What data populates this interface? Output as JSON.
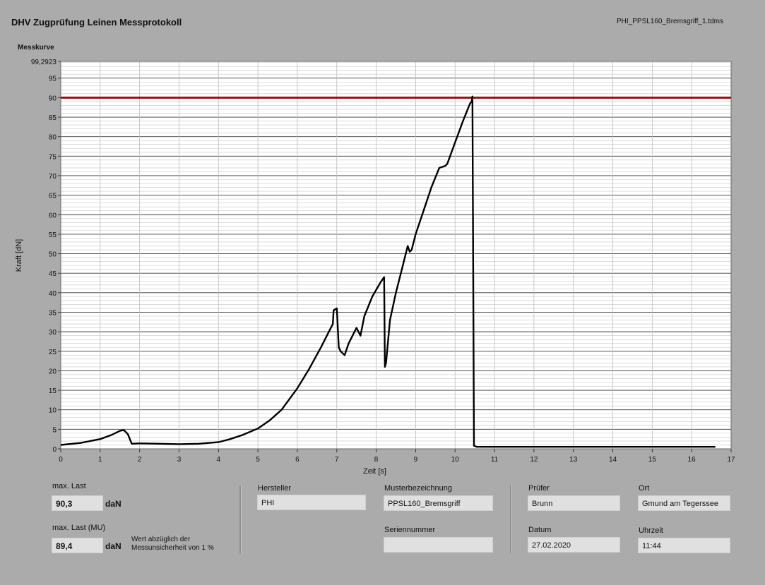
{
  "header": {
    "title": "DHV Zugprüfung Leinen Messprotokoll",
    "filename": "PHI_PPSL160_Bremsgriff_1.tdms",
    "chart_label": "Messkurve"
  },
  "colors": {
    "background": "#ababab",
    "plot_bg": "#ffffff",
    "limit_line": "#9b1010",
    "curve": "#000000"
  },
  "chart_data": {
    "type": "line",
    "xlabel": "Zeit [s]",
    "ylabel": "Kraft [dN]",
    "xlim": [
      0,
      17
    ],
    "ylim": [
      0,
      99.2923
    ],
    "ymax_label": "99,2923",
    "xticks": [
      "0",
      "1",
      "2",
      "3",
      "4",
      "5",
      "6",
      "7",
      "8",
      "9",
      "10",
      "11",
      "12",
      "13",
      "14",
      "15",
      "16",
      "17"
    ],
    "yticks": [
      "0",
      "5",
      "10",
      "15",
      "20",
      "25",
      "30",
      "35",
      "40",
      "45",
      "50",
      "55",
      "60",
      "65",
      "70",
      "75",
      "80",
      "85",
      "90",
      "95"
    ],
    "grid": true,
    "series": [
      {
        "role": "limit",
        "x": [
          0,
          17
        ],
        "y": [
          90,
          90
        ]
      },
      {
        "role": "measurement",
        "x": [
          0,
          0.5,
          1.0,
          1.3,
          1.5,
          1.6,
          1.7,
          1.8,
          2.0,
          2.5,
          3.0,
          3.5,
          4.0,
          4.3,
          4.6,
          5.0,
          5.3,
          5.6,
          6.0,
          6.3,
          6.6,
          6.9,
          6.92,
          7.0,
          7.05,
          7.1,
          7.2,
          7.3,
          7.4,
          7.5,
          7.6,
          7.7,
          7.9,
          8.1,
          8.2,
          8.22,
          8.25,
          8.35,
          8.5,
          8.7,
          8.8,
          8.85,
          8.9,
          9.0,
          9.2,
          9.4,
          9.6,
          9.75,
          9.8,
          10.0,
          10.2,
          10.3,
          10.38,
          10.42,
          10.44,
          10.48,
          10.55,
          11,
          12,
          13,
          14,
          15,
          16,
          16.6
        ],
        "y": [
          1.0,
          1.5,
          2.5,
          3.6,
          4.6,
          4.8,
          3.8,
          1.3,
          1.4,
          1.3,
          1.2,
          1.3,
          1.7,
          2.5,
          3.5,
          5.2,
          7.3,
          10.0,
          15.5,
          20.5,
          26.0,
          32.0,
          35.5,
          36.0,
          26.0,
          25.0,
          24.0,
          27.0,
          29.0,
          31.0,
          29.0,
          34.0,
          39.0,
          42.5,
          44.0,
          21.0,
          22.0,
          33.0,
          40.0,
          48.0,
          52.0,
          50.5,
          51.0,
          55.0,
          61.0,
          67.0,
          72.0,
          72.5,
          73.0,
          78.5,
          84.0,
          86.5,
          88.5,
          89.0,
          90.3,
          0.8,
          0.5,
          0.5,
          0.5,
          0.5,
          0.5,
          0.5,
          0.5,
          0.5
        ]
      }
    ]
  },
  "results": {
    "max_label": "max. Last",
    "max_value": "90,3",
    "max_unit": "daN",
    "max_mu_label": "max. Last (MU)",
    "max_mu_value": "89,4",
    "max_mu_unit": "daN",
    "mu_note_line1": "Wert abzüglich der",
    "mu_note_line2": "Messunsicherheit von 1 %"
  },
  "info": {
    "hersteller_label": "Hersteller",
    "hersteller_value": "PHI",
    "muster_label": "Musterbezeichnung",
    "muster_value": "PPSL160_Bremsgriff",
    "serien_label": "Seriennummer",
    "serien_value": "",
    "pruefer_label": "Prüfer",
    "pruefer_value": "Brunn",
    "datum_label": "Datum",
    "datum_value": "27.02.2020",
    "ort_label": "Ort",
    "ort_value": "Gmund am Tegerssee",
    "uhrzeit_label": "Uhrzeit",
    "uhrzeit_value": "11:44"
  }
}
